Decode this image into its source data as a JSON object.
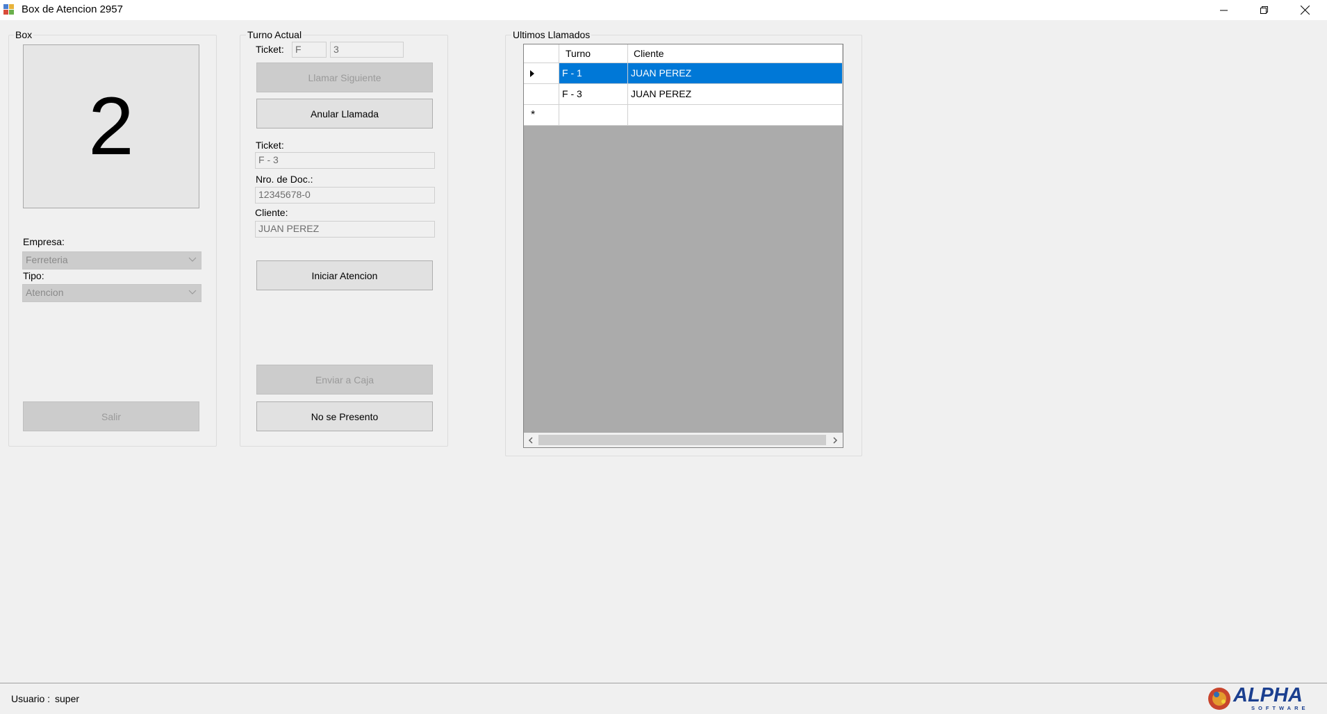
{
  "window": {
    "title": "Box de Atencion 2957",
    "min_icon": "minimize-icon",
    "max_icon": "restore-icon",
    "close_icon": "close-icon"
  },
  "box_group": {
    "legend": "Box",
    "box_number": "2",
    "empresa_label": "Empresa:",
    "empresa_value": "Ferreteria",
    "tipo_label": "Tipo:",
    "tipo_value": "Atencion",
    "salir_label": "Salir"
  },
  "turno_group": {
    "legend": "Turno Actual",
    "ticket_label": "Ticket:",
    "ticket_prefix": "F",
    "ticket_number": "3",
    "llamar_siguiente_label": "Llamar Siguiente",
    "anular_llamada_label": "Anular Llamada",
    "ticket_field_label": "Ticket:",
    "ticket_field_value": "F - 3",
    "doc_label": "Nro. de Doc.:",
    "doc_value": "12345678-0",
    "cliente_label": "Cliente:",
    "cliente_value": "JUAN PEREZ",
    "iniciar_atencion_label": "Iniciar Atencion",
    "enviar_caja_label": "Enviar a Caja",
    "no_presento_label": "No se Presento"
  },
  "ultimos_group": {
    "legend": "Ultimos Llamados",
    "columns": [
      "Turno",
      "Cliente"
    ],
    "rows": [
      {
        "turno": "F - 1",
        "cliente": "JUAN PEREZ",
        "selected": true
      },
      {
        "turno": "F - 3",
        "cliente": "JUAN PEREZ",
        "selected": false
      }
    ],
    "new_row_marker": "*"
  },
  "statusbar": {
    "user_label": "Usuario :",
    "user_value": "super",
    "logo_text": "ALPHA",
    "logo_subtext": "SOFTWARE"
  },
  "colors": {
    "selection": "#0078d7",
    "window_bg": "#f0f0f0",
    "grid_bg": "#ababab",
    "logo_blue": "#1b3f8f"
  }
}
